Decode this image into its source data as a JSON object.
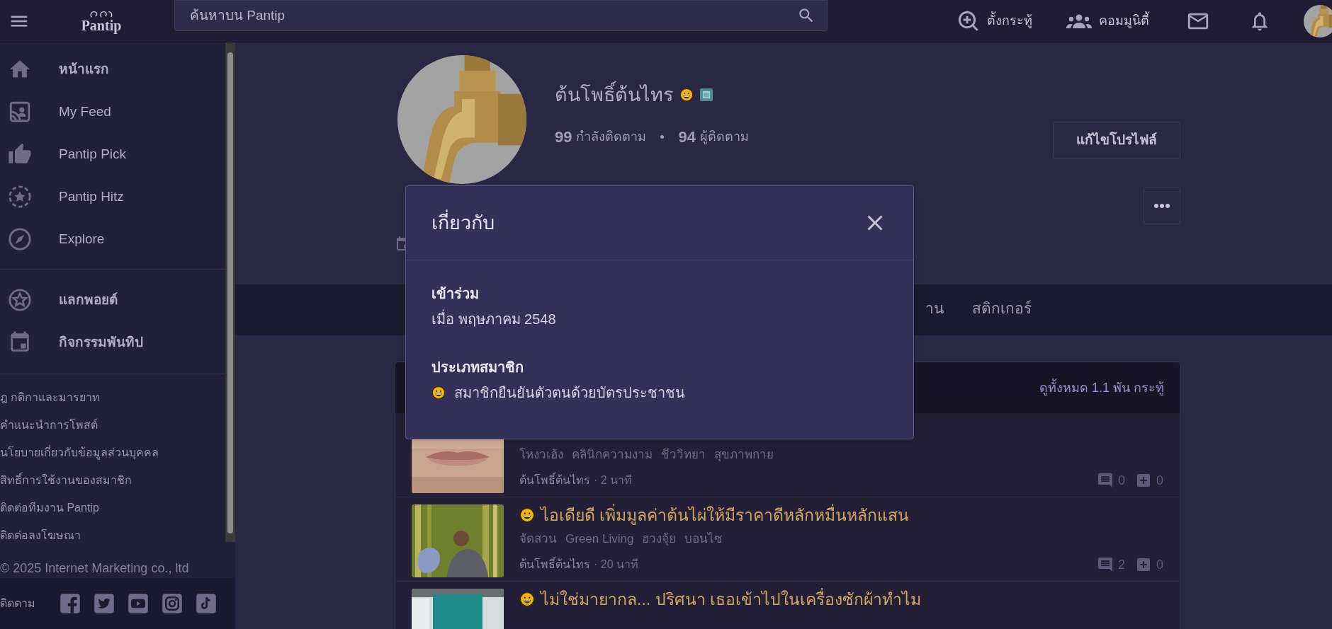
{
  "header": {
    "logo": "Pantip",
    "search": {
      "placeholder": "ค้นหาบน Pantip"
    },
    "actions": [
      {
        "kind": "new",
        "label": "ตั้งกระทู้"
      },
      {
        "kind": "community",
        "label": "คอมมูนิตี้"
      },
      {
        "kind": "mail"
      },
      {
        "kind": "bell"
      },
      {
        "kind": "avatar"
      }
    ]
  },
  "sidebar": {
    "main": [
      {
        "kind": "home",
        "label": "หน้าแรก"
      },
      {
        "kind": "feed",
        "label": "My Feed"
      },
      {
        "kind": "pick",
        "label": "Pantip Pick"
      },
      {
        "kind": "hitz",
        "label": "Pantip Hitz"
      },
      {
        "kind": "explore",
        "label": "Explore"
      }
    ],
    "extra": [
      {
        "kind": "points",
        "label": "แลกพอยต์"
      },
      {
        "kind": "calendar",
        "label": "กิจกรรมพันทิป"
      }
    ],
    "links": [
      "ฎ กติกาและมารยาท",
      "คำแนะนำการโพสต์",
      "นโยบายเกี่ยวกับข้อมูลส่วนบุคคล",
      "สิทธิ์การใช้งานของสมาชิก",
      "ติดต่อทีมงาน Pantip",
      "ติดต่อลงโฆษณา"
    ],
    "copyright": "© 2025 Internet Marketing co., ltd",
    "follow": {
      "label": "ติดตาม"
    }
  },
  "profile": {
    "name": "ต้นโพธิ์ต้นไทร",
    "following_count": "99",
    "following_label": "กำลังติดตาม",
    "followers_count": "94",
    "followers_label": "ผู้ติดตาม",
    "edit_button": "แก้ไขโปรไฟล์"
  },
  "tabs": [
    {
      "label": "าน",
      "selected": false
    },
    {
      "label": "สติกเกอร์",
      "selected": false
    }
  ],
  "posts": {
    "view_all": "ดูทั้งหมด 1.1 พัน กระทู้",
    "items": [
      {
        "tags": [
          "โหงวเฮ้ง",
          "คลินิกความงาม",
          "ชีววิทยา",
          "สุขภาพกาย"
        ],
        "author": "ต้นโพธิ์ต้นไทร",
        "time": "· 2 นาที",
        "comments": "0",
        "votes": "0"
      },
      {
        "title": "ไอเดียดี เพิ่มมูลค่าต้นไผ่ให้มีราคาดีหลักหมื่นหลักแสน",
        "tags": [
          "จัดสวน",
          "Green Living",
          "ฮวงจุ้ย",
          "บอนไซ"
        ],
        "author": "ต้นโพธิ์ต้นไทร",
        "time": "· 20 นาที",
        "comments": "2",
        "votes": "0"
      },
      {
        "title": "ไม่ใช่มายากล... ปริศนา เธอเข้าไปในเครื่องซักผ้าทำไม"
      }
    ]
  },
  "modal": {
    "title": "เกี่ยวกับ",
    "sections": [
      {
        "heading": "เข้าร่วม",
        "text": "เมื่อ พฤษภาคม 2548"
      },
      {
        "heading": "ประเภทสมาชิก",
        "text": "สมาชิกยืนยันตัวตนด้วยบัตรประชาชน",
        "kind": "verified"
      }
    ]
  }
}
